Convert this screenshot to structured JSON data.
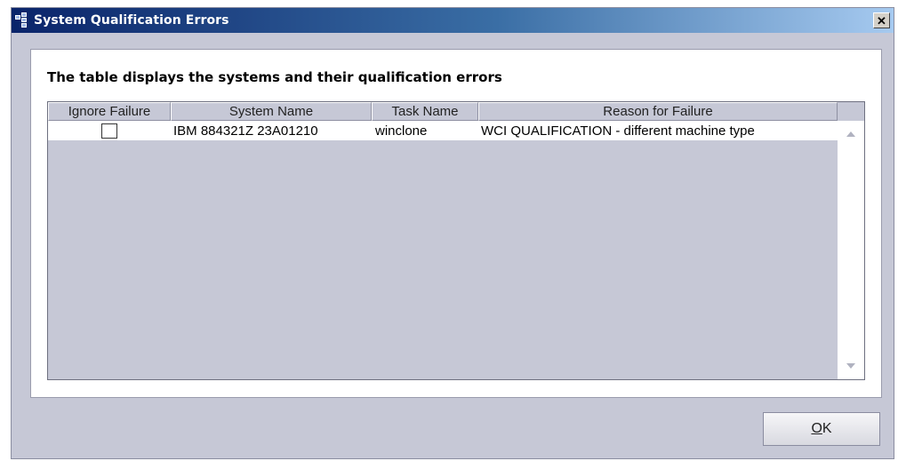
{
  "window": {
    "title": "System Qualification Errors",
    "close_glyph": "✕"
  },
  "panel": {
    "description": "The table displays the systems and their qualification errors"
  },
  "table": {
    "columns": [
      "Ignore Failure",
      "System Name",
      "Task Name",
      "Reason for Failure"
    ],
    "rows": [
      {
        "ignore": false,
        "system_name": "IBM 884321Z 23A01210",
        "task_name": "winclone",
        "reason": "WCI QUALIFICATION - different machine type"
      }
    ]
  },
  "buttons": {
    "ok_mnemonic": "O",
    "ok_rest": "K"
  },
  "icons": {
    "app": "app-window-icon",
    "close": "close-icon",
    "scroll_up": "scroll-up-arrow-icon",
    "scroll_down": "scroll-down-arrow-icon"
  },
  "colors": {
    "title_gradient_start": "#0a246a",
    "title_gradient_end": "#a6caf0",
    "dialog_bg": "#c6c8d6"
  }
}
